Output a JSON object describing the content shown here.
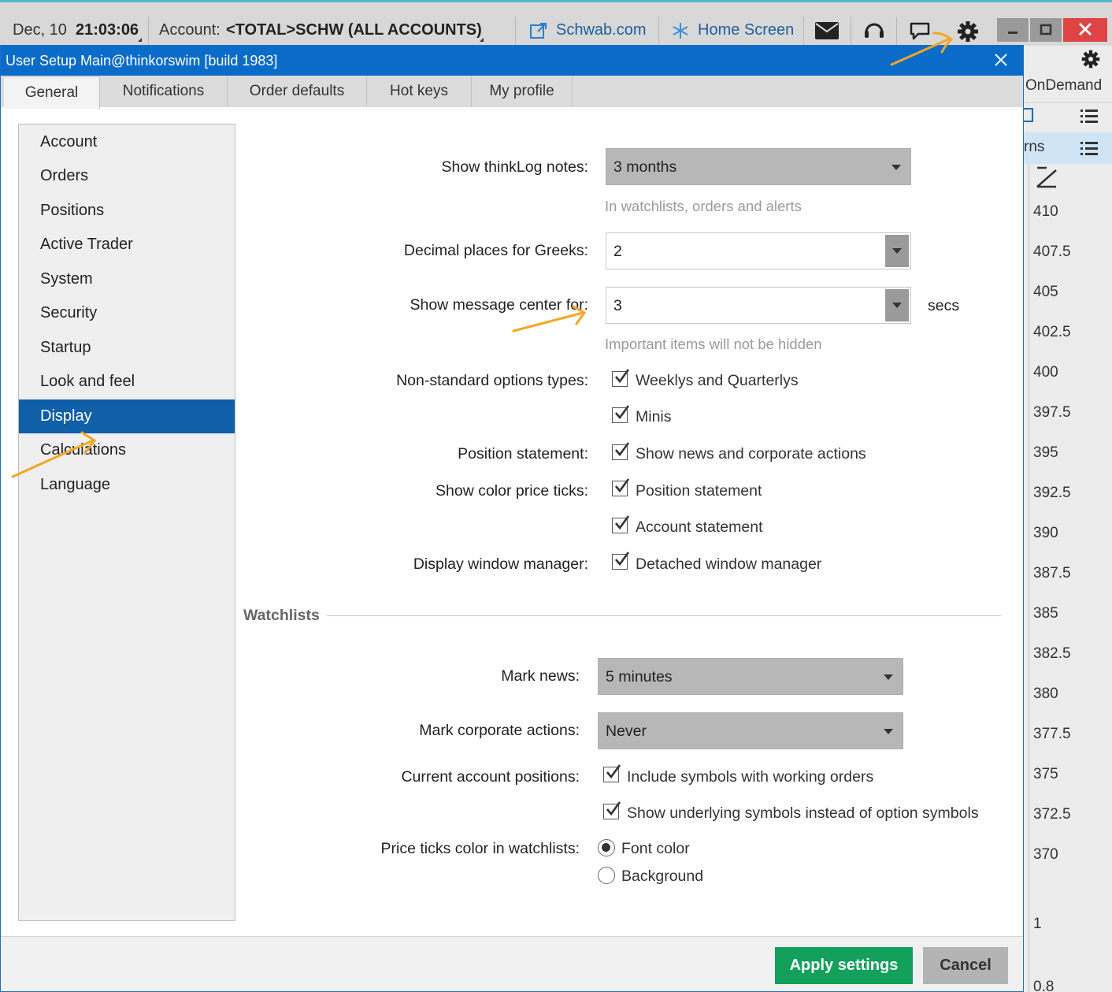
{
  "topbar": {
    "date": "Dec, 10",
    "time": "21:03:06",
    "account_label": "Account:",
    "account_value": "<TOTAL>SCHW (ALL ACCOUNTS)",
    "schwab_link": "Schwab.com",
    "home_screen": "Home Screen",
    "icons": [
      "external-link-icon",
      "home-screen-icon",
      "mail-icon",
      "headset-icon",
      "chat-icon",
      "gear-icon",
      "minimize-icon",
      "maximize-icon",
      "close-icon"
    ]
  },
  "background_panel": {
    "ondemand": "OnDemand",
    "partial_label": "rns",
    "prices": [
      "410",
      "407.5",
      "405",
      "402.5",
      "400",
      "397.5",
      "395",
      "392.5",
      "390",
      "387.5",
      "385",
      "382.5",
      "380",
      "377.5",
      "375",
      "372.5",
      "370",
      "1",
      "0.8"
    ]
  },
  "dialog": {
    "title": "User Setup Main@thinkorswim [build 1983]",
    "tabs": [
      {
        "label": "General",
        "active": true
      },
      {
        "label": "Notifications",
        "active": false
      },
      {
        "label": "Order defaults",
        "active": false
      },
      {
        "label": "Hot keys",
        "active": false
      },
      {
        "label": "My profile",
        "active": false
      }
    ],
    "sidebar": [
      {
        "label": "Account"
      },
      {
        "label": "Orders"
      },
      {
        "label": "Positions"
      },
      {
        "label": "Active Trader"
      },
      {
        "label": "System"
      },
      {
        "label": "Security"
      },
      {
        "label": "Startup"
      },
      {
        "label": "Look and feel"
      },
      {
        "label": "Display",
        "active": true
      },
      {
        "label": "Calculations"
      },
      {
        "label": "Language"
      }
    ],
    "settings": {
      "thinklog_label": "Show thinkLog notes:",
      "thinklog_value": "3 months",
      "thinklog_hint": "In watchlists, orders and alerts",
      "greeks_label": "Decimal places for Greeks:",
      "greeks_value": "2",
      "msgcenter_label": "Show message center for:",
      "msgcenter_value": "3",
      "msgcenter_unit": "secs",
      "msgcenter_hint": "Important items will not be hidden",
      "nonstd_label": "Non-standard options types:",
      "nonstd_opt1": "Weeklys and Quarterlys",
      "nonstd_opt2": "Minis",
      "posstmt_label": "Position statement:",
      "posstmt_opt1": "Show news and corporate actions",
      "colorticks_label": "Show color price ticks:",
      "colorticks_opt1": "Position statement",
      "colorticks_opt2": "Account statement",
      "winmgr_label": "Display window manager:",
      "winmgr_opt1": "Detached window manager"
    },
    "watchlists": {
      "section_title": "Watchlists",
      "marknews_label": "Mark news:",
      "marknews_value": "5 minutes",
      "markcorp_label": "Mark corporate actions:",
      "markcorp_value": "Never",
      "curpos_label": "Current account positions:",
      "curpos_opt1": "Include symbols with working orders",
      "curpos_opt2": "Show underlying symbols instead of option symbols",
      "ticks_label": "Price ticks color in watchlists:",
      "ticks_opt1": "Font color",
      "ticks_opt2": "Background",
      "ticks_selected": "Font color"
    },
    "footer": {
      "apply": "Apply settings",
      "cancel": "Cancel"
    }
  },
  "colors": {
    "title_bar": "#0b6bc8",
    "selected_nav": "#0f5fa9",
    "apply_button": "#13a05b",
    "annotation_arrow": "#f5a623",
    "close_button": "#e04343"
  }
}
